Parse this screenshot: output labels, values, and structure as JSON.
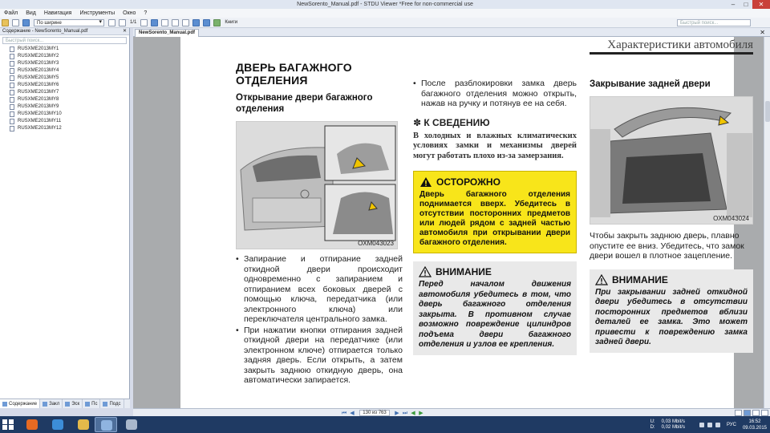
{
  "window": {
    "title": "NewSorento_Manual.pdf - STDU Viewer *Free for non-commercial use",
    "min": "–",
    "max": "□",
    "close": "✕"
  },
  "menu": [
    "Файл",
    "Вид",
    "Навигация",
    "Инструменты",
    "Окно",
    "?"
  ],
  "toolbar": {
    "page_fraction": "1/1",
    "zoom_value": "По ширине",
    "books_label": "Книги",
    "search_placeholder": "Быстрый поиск..."
  },
  "sidebar": {
    "header": "Содержание - NewSorento_Manual.pdf",
    "close": "✕",
    "search_placeholder": "Быстрый поиск...",
    "items": [
      "RUSXME2013MY1",
      "RUSXME2013MY2",
      "RUSXME2013MY3",
      "RUSXME2013MY4",
      "RUSXME2013MY5",
      "RUSXME2013MY6",
      "RUSXME2013MY7",
      "RUSXME2013MY8",
      "RUSXME2013MY9",
      "RUSXME2013MY10",
      "RUSXME2013MY11",
      "RUSXME2013MY12"
    ],
    "tabs": [
      "Содержание",
      "Закл",
      "Эск",
      "Пс",
      "Подс"
    ]
  },
  "doc_tab": {
    "label": "NewSorento_Manual.pdf",
    "close": "✕"
  },
  "page": {
    "header": "Характеристики автомобиля",
    "section_title": "ДВЕРЬ БАГАЖНОГО ОТДЕЛЕНИЯ",
    "col1": {
      "subtitle": "Открывание двери багажного отделения",
      "figure_code": "OXM043023",
      "bullets": [
        "Запирание и отпирание задней откидной двери происходит одновременно с запиранием и отпиранием всех боковых дверей с помощью ключа, передатчика (или электронного ключа) или переключателя центрального замка.",
        "При нажатии кнопки отпирания задней откидной двери на передатчике (или электронном ключе) отпирается только задняя дверь. Если открыть, а затем закрыть заднюю откидную дверь, она автоматически запирается."
      ]
    },
    "col2": {
      "bullet": "После разблокировки замка дверь багажного отделения можно открыть, нажав на ручку и потянув ее на себя.",
      "notice_title": "✽ К СВЕДЕНИЮ",
      "notice_body": "В холодных и влажных климатических условиях замки и механизмы дверей могут работать плохо из-за замерзания.",
      "warning_title": "ОСТОРОЖНО",
      "warning_body": "Дверь багажного отделения поднимается вверх. Убедитесь в отсутствии посторонних предметов или людей рядом с задней частью автомобиля при открывании двери багажного отделения.",
      "caution_title": "ВНИМАНИЕ",
      "caution_body": "Перед началом движения автомобиля убедитесь в том, что дверь багажного отделения закрыта. В противном случае возможно повреждение цилиндров подъема двери багажного отделения и узлов ее крепления."
    },
    "col3": {
      "subtitle": "Закрывание задней двери",
      "figure_code": "OXM043024",
      "text": "Чтобы закрыть заднюю дверь, плавно опустите ее вниз. Убедитесь, что замок двери вошел в плотное зацепление.",
      "caution_title": "ВНИМАНИЕ",
      "caution_body": "При закрывании задней откидной двери убедитесь в отсутствии посторонних предметов вблизи деталей ее замка. Это может привести к повреждению замка задней двери."
    }
  },
  "navbar": {
    "page_indicator": "130 из 763"
  },
  "taskbar": {
    "net_u_label": "U:",
    "net_u_value": "0,03 Mbit/s",
    "net_d_label": "D:",
    "net_d_value": "0,02 Mbit/s",
    "lang": "РУС",
    "time": "16:52",
    "date": "09.03.2015"
  },
  "colors": {
    "warning_bg": "#f8e51a",
    "caution_bg": "#e9e9e9",
    "taskbar": "#1f3a63"
  }
}
